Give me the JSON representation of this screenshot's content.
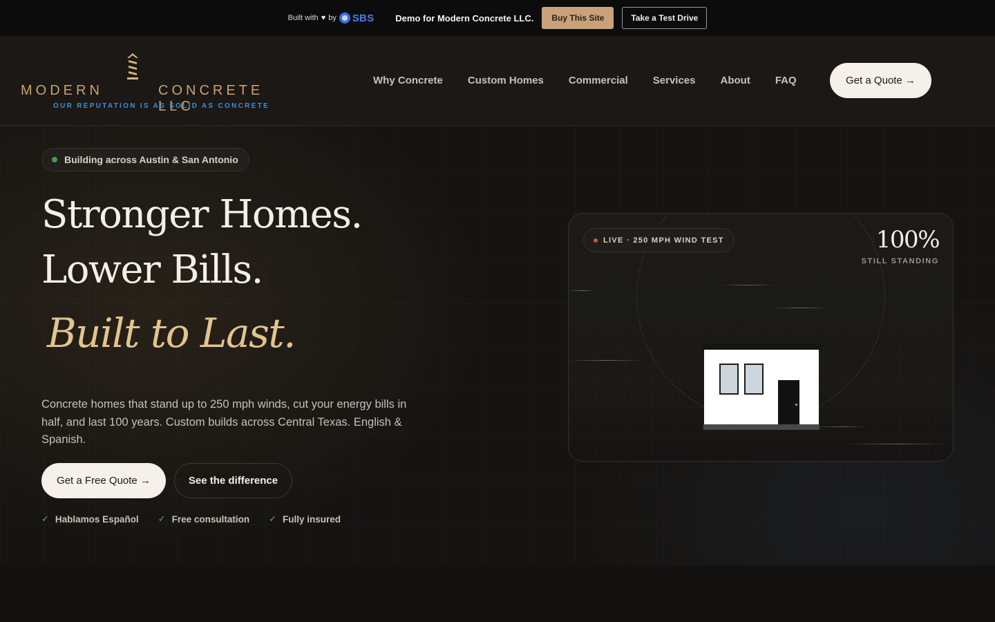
{
  "topbar": {
    "built_with": "Built with",
    "by": "by",
    "brand": "SBS",
    "demo_text": "Demo for Modern Concrete LLC.",
    "buy_label": "Buy This Site",
    "test_label": "Take a Test Drive"
  },
  "header": {
    "logo_left": "MODERN",
    "logo_right": "CONCRETE LLC",
    "logo_tagline": "OUR REPUTATION IS AS SOLID AS CONCRETE",
    "nav": [
      "Why Concrete",
      "Custom Homes",
      "Commercial",
      "Services",
      "About",
      "FAQ"
    ],
    "cta_label": "Get a Quote →"
  },
  "hero": {
    "location_pill": "Building across Austin & San Antonio",
    "headline_1": "Stronger Homes.",
    "headline_2": "Lower Bills.",
    "headline_3": "Built to Last.",
    "description": "Concrete homes that stand up to 250 mph winds, cut your energy bills in half, and last 100 years. Custom builds across Central Texas. English & Spanish.",
    "primary_cta": "Get a Free Quote →",
    "secondary_cta": "See the difference",
    "checks": [
      "Hablamos Español",
      "Free consultation",
      "Fully insured"
    ]
  },
  "wind_card": {
    "live_label": "LIVE · 250 MPH WIND TEST",
    "stat_value": "100%",
    "stat_label": "STILL STANDING"
  },
  "colors": {
    "accent_gold": "#c9a470",
    "headline_gold": "#e2c48e",
    "tagline_blue": "#3f8fd8",
    "buy_button": "#c9a27a",
    "live_dot": "#d0563d",
    "check_green": "#5fae63"
  }
}
